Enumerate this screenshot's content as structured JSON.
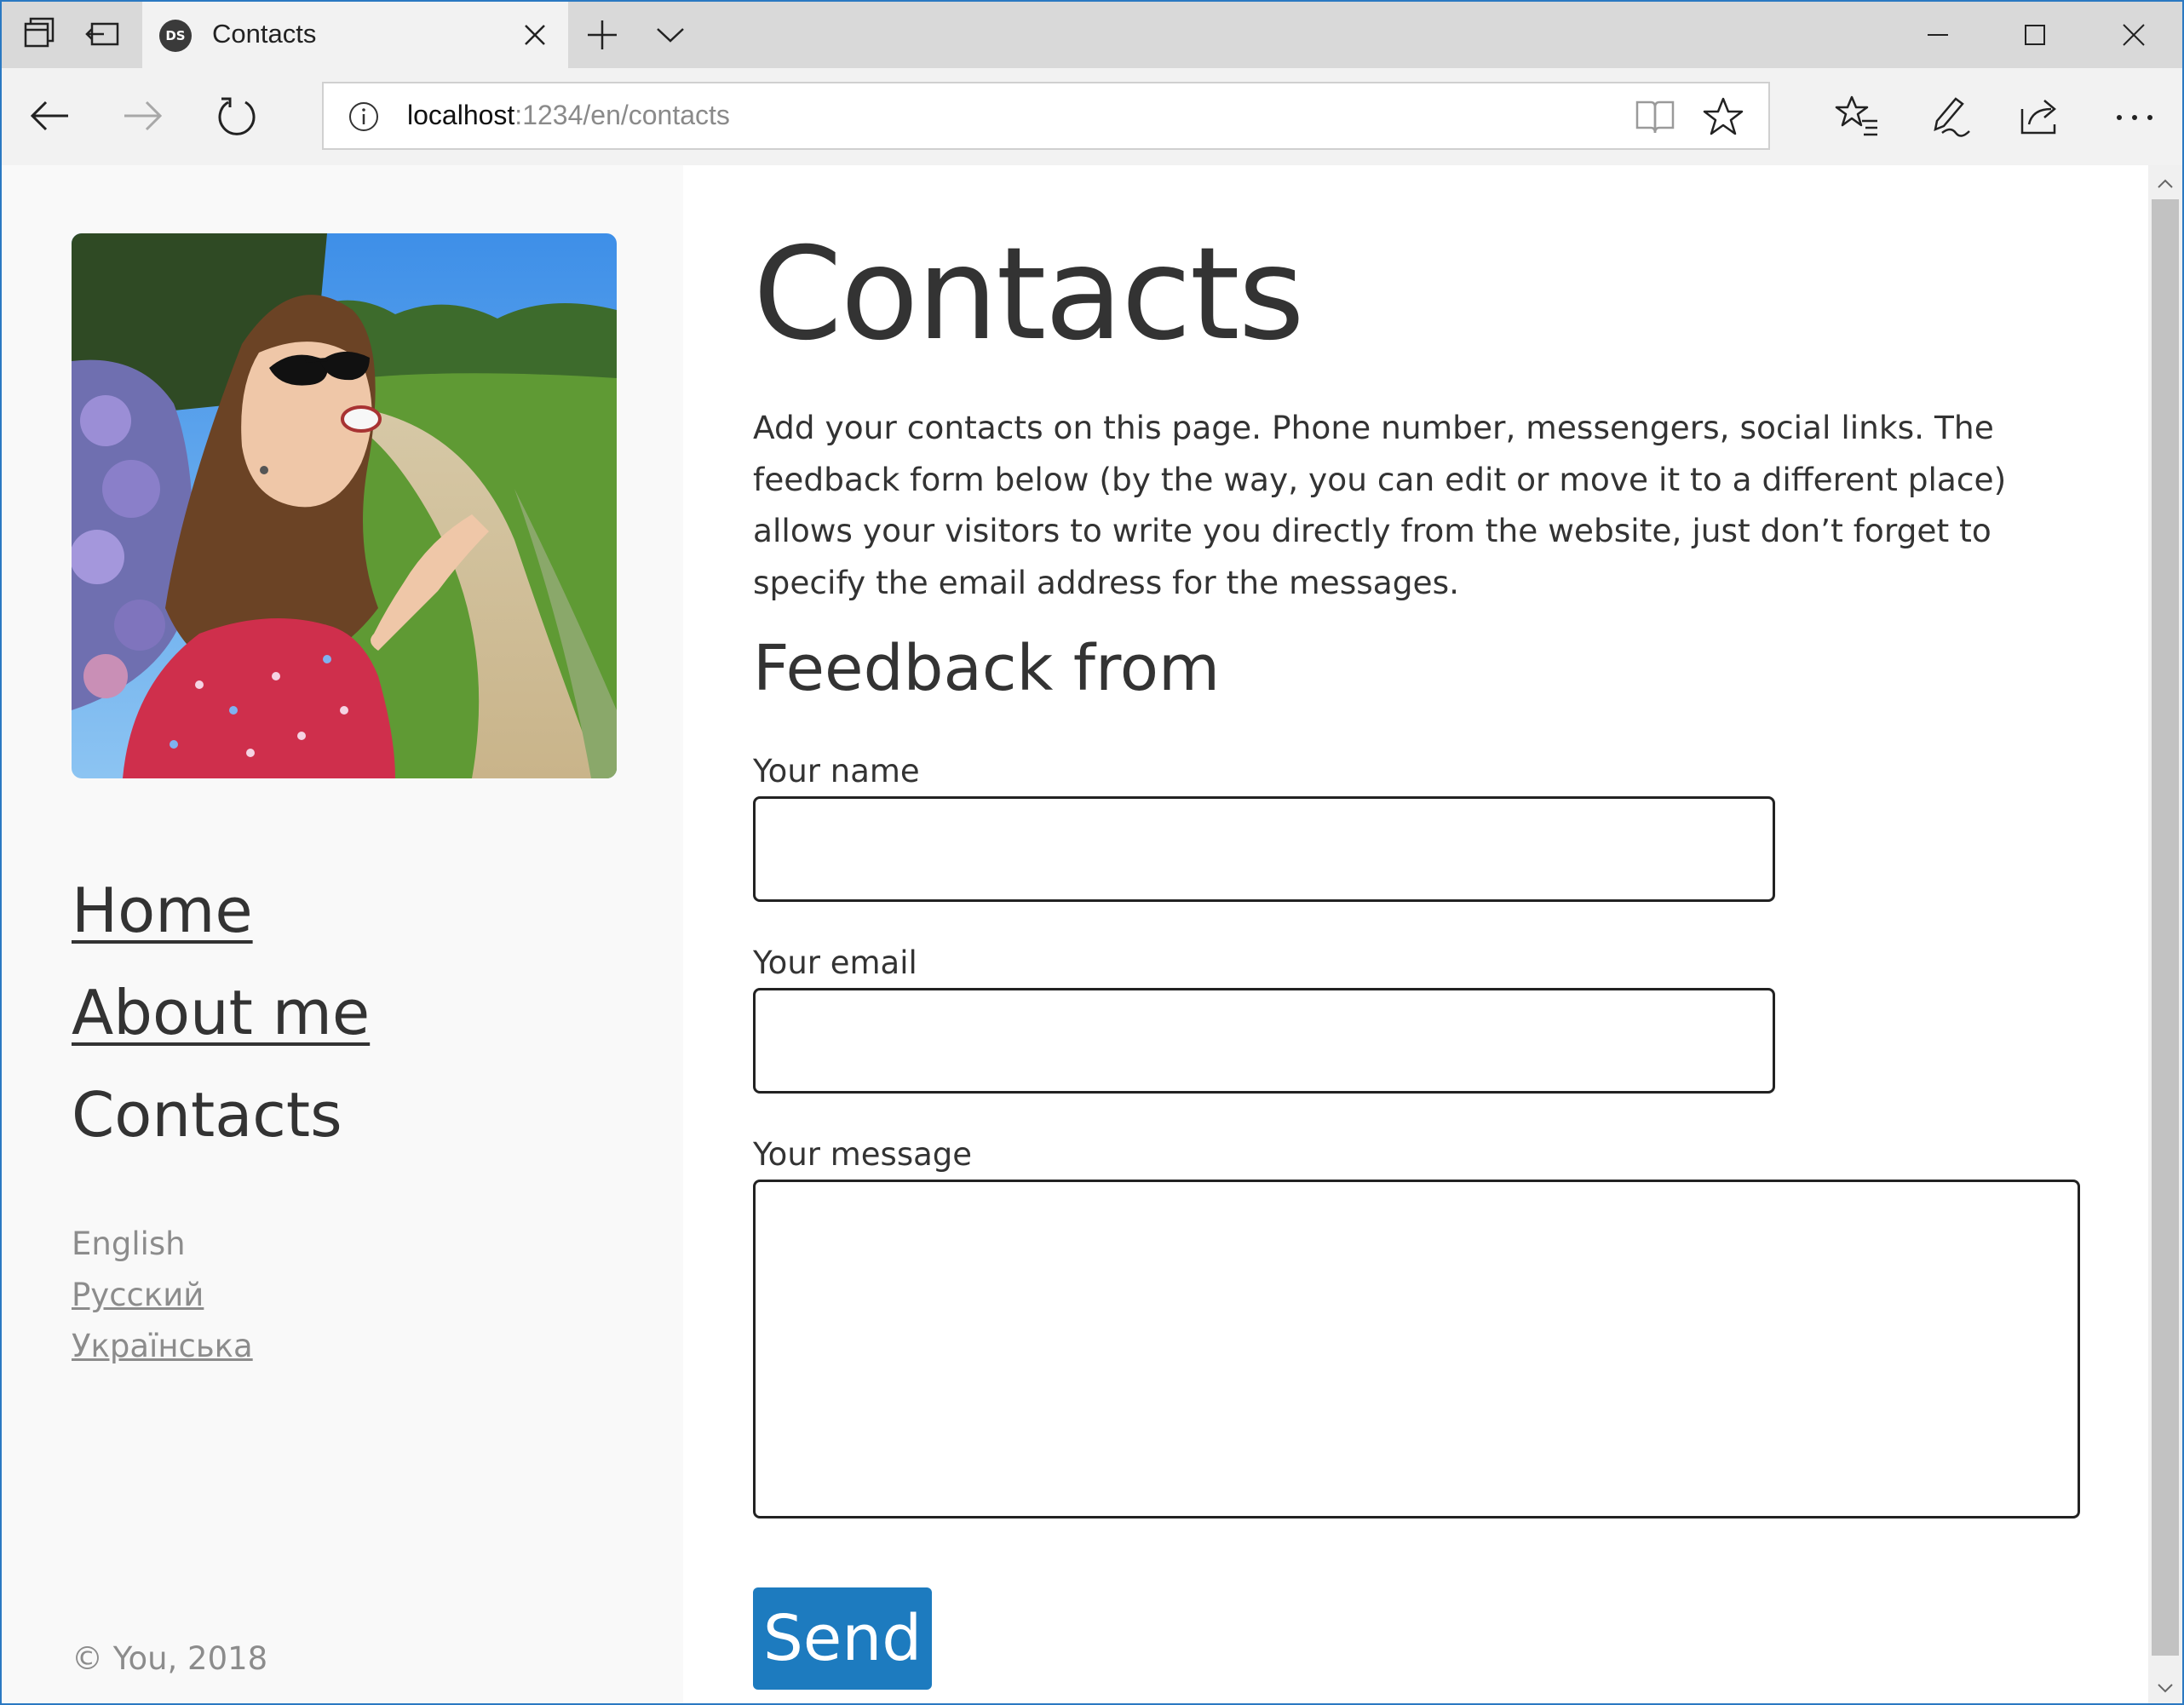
{
  "browser": {
    "tab_title": "Contacts",
    "tab_favicon": "DS",
    "url_host": "localhost",
    "url_path": ":1234/en/contacts"
  },
  "icons": {
    "tab_actions": [
      "tab-preview-icon",
      "set-aside-tabs-icon"
    ],
    "nav": [
      "back-arrow-icon",
      "forward-arrow-icon",
      "refresh-icon"
    ],
    "address_bar": [
      "info-icon",
      "reading-view-icon",
      "favorite-star-icon"
    ],
    "toolbar": [
      "favorites-hub-icon",
      "web-note-icon",
      "share-icon",
      "more-icon"
    ],
    "window": [
      "minimize-icon",
      "maximize-icon",
      "close-icon"
    ]
  },
  "sidebar": {
    "nav": [
      {
        "label": "Home",
        "current": false
      },
      {
        "label": "About me",
        "current": false
      },
      {
        "label": "Contacts",
        "current": true
      }
    ],
    "languages": [
      {
        "label": "English",
        "current": true
      },
      {
        "label": "Русский",
        "current": false
      },
      {
        "label": "Українська",
        "current": false
      }
    ],
    "copyright": "© You, 2018"
  },
  "main": {
    "title": "Contacts",
    "intro": "Add your contacts on this page. Phone number, messengers, social links. The feedback form below (by the way, you can edit or move it to a different place) allows your visitors to write you directly from the website, just don’t forget to specify the email address for the messages.",
    "form_title": "Feedback from",
    "fields": {
      "name_label": "Your name",
      "name_value": "",
      "email_label": "Your email",
      "email_value": "",
      "message_label": "Your message",
      "message_value": ""
    },
    "send_label": "Send"
  },
  "colors": {
    "accent": "#1d7bbf",
    "sidebar_bg": "#f9f9f9",
    "text": "#333333",
    "muted": "#8c8c8c",
    "chrome_border": "#2b79c2"
  }
}
